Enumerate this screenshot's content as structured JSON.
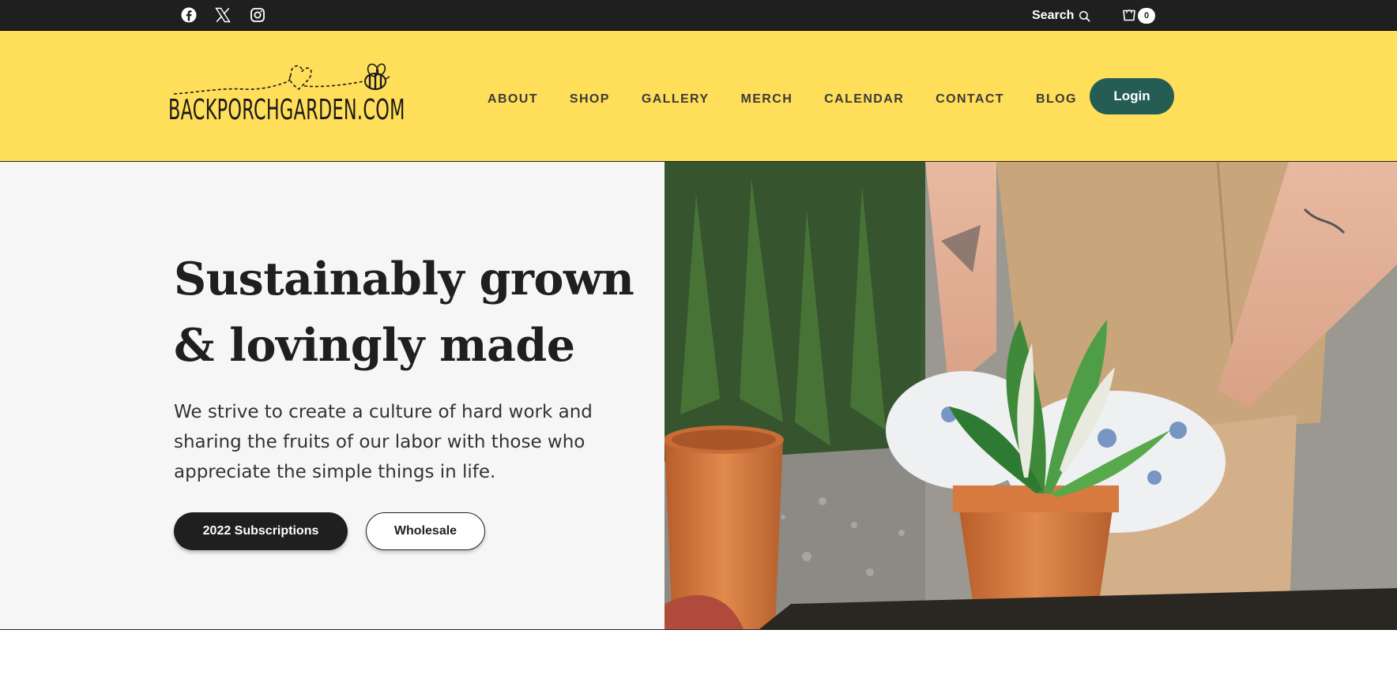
{
  "topbar": {
    "social": [
      {
        "icon": "facebook-icon"
      },
      {
        "icon": "x-twitter-icon"
      },
      {
        "icon": "instagram-icon"
      }
    ],
    "search_label": "Search",
    "cart_count": "0"
  },
  "header": {
    "logo_text": "BACKPORCHGARDEN.COM",
    "nav": [
      "ABOUT",
      "SHOP",
      "GALLERY",
      "MERCH",
      "CALENDAR",
      "CONTACT",
      "BLOG"
    ],
    "login_label": "Login"
  },
  "hero": {
    "headline_line1": "Sustainably grown",
    "headline_line2": "& lovingly made",
    "lede": "We strive to create a culture of hard work and sharing the fruits of our labor with those who appreciate the simple things in life.",
    "primary_button": "2022 Subscriptions",
    "secondary_button": "Wholesale"
  },
  "colors": {
    "topbar": "#1f1f1f",
    "header": "#ffde59",
    "accent": "#255d55",
    "hero_bg": "#f6f6f6"
  }
}
